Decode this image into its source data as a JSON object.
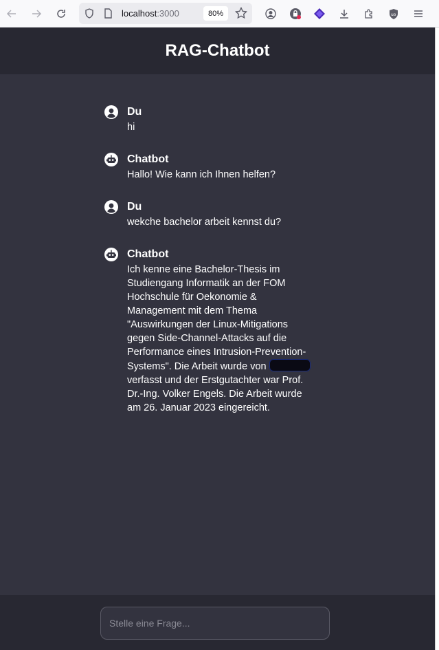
{
  "browser": {
    "url_host": "localhost",
    "url_port": ":3000",
    "zoom": "80%"
  },
  "app": {
    "title": "RAG-Chatbot"
  },
  "messages": [
    {
      "author": "Du",
      "icon": "user-circle-icon",
      "text": "hi"
    },
    {
      "author": "Chatbot",
      "icon": "robot-icon",
      "text": "Hallo! Wie kann ich Ihnen helfen?"
    },
    {
      "author": "Du",
      "icon": "user-circle-icon",
      "text": "wekche bachelor arbeit kennst du?"
    },
    {
      "author": "Chatbot",
      "icon": "robot-icon",
      "text_before": "Ich kenne eine Bachelor-Thesis im Studiengang Informatik an der FOM Hochschule für Oekonomie & Management mit dem Thema \"Auswirkungen der Linux-Mitigations gegen Side-Channel-Attacks auf die Performance eines Intrusion-Prevention-Systems\". Die Arbeit wurde von",
      "text_after": "verfasst und der Erstgutachter war Prof. Dr.-Ing. Volker Engels. Die Arbeit wurde am 26. Januar 2023 eingereicht."
    }
  ],
  "input": {
    "placeholder": "Stelle eine Frage..."
  },
  "colors": {
    "background": "#33333f",
    "header": "#282832",
    "text": "#ffffff"
  }
}
